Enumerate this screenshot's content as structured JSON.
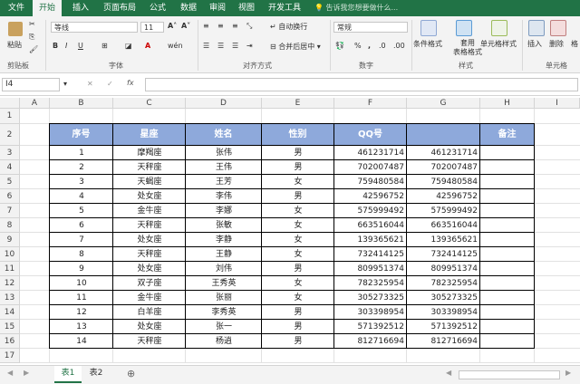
{
  "ribbon_tabs": [
    {
      "label": "文件"
    },
    {
      "label": "开始"
    },
    {
      "label": "插入"
    },
    {
      "label": "页面布局"
    },
    {
      "label": "公式"
    },
    {
      "label": "数据"
    },
    {
      "label": "审阅"
    },
    {
      "label": "视图"
    },
    {
      "label": "开发工具"
    }
  ],
  "active_tab": "开始",
  "tell_me": "告诉我您想要做什么...",
  "ribbon": {
    "paste": "粘贴",
    "clipboard": "剪贴板",
    "font_name": "等线",
    "font_size": "11",
    "font_group": "字体",
    "wrap_text": "自动换行",
    "merge_center": "合并后居中",
    "alignment_group": "对齐方式",
    "number_format": "常规",
    "number_group": "数字",
    "conditional_format": "条件格式",
    "format_as_table": "套用\n表格格式",
    "cell_styles": "单元格样式",
    "styles_group": "样式",
    "insert": "插入",
    "delete": "删除",
    "format": "格",
    "cells_group": "单元格"
  },
  "formula_bar": {
    "name_box": "I4",
    "fx": "fx",
    "content": ""
  },
  "columns": [
    "A",
    "B",
    "C",
    "D",
    "E",
    "F",
    "G",
    "H",
    "I"
  ],
  "rows": [
    "1",
    "2",
    "3",
    "4",
    "5",
    "6",
    "7",
    "8",
    "9",
    "10",
    "11",
    "12",
    "13",
    "14",
    "15",
    "16",
    "17"
  ],
  "table": {
    "headers": [
      "序号",
      "星座",
      "姓名",
      "性别",
      "QQ号",
      "",
      "备注"
    ],
    "data": [
      [
        "1",
        "摩羯座",
        "张伟",
        "男",
        "461231714",
        "461231714"
      ],
      [
        "2",
        "天秤座",
        "王伟",
        "男",
        "702007487",
        "702007487"
      ],
      [
        "3",
        "天蝎座",
        "王芳",
        "女",
        "759480584",
        "759480584"
      ],
      [
        "4",
        "处女座",
        "李伟",
        "男",
        "42596752",
        "42596752"
      ],
      [
        "5",
        "金牛座",
        "李娜",
        "女",
        "575999492",
        "575999492"
      ],
      [
        "6",
        "天秤座",
        "张敏",
        "女",
        "663516044",
        "663516044"
      ],
      [
        "7",
        "处女座",
        "李静",
        "女",
        "139365621",
        "139365621"
      ],
      [
        "8",
        "天秤座",
        "王静",
        "女",
        "732414125",
        "732414125"
      ],
      [
        "9",
        "处女座",
        "刘伟",
        "男",
        "809951374",
        "809951374"
      ],
      [
        "10",
        "双子座",
        "王秀英",
        "女",
        "782325954",
        "782325954"
      ],
      [
        "11",
        "金牛座",
        "张丽",
        "女",
        "305273325",
        "305273325"
      ],
      [
        "12",
        "白羊座",
        "李秀英",
        "男",
        "303398954",
        "303398954"
      ],
      [
        "13",
        "处女座",
        "张一",
        "男",
        "571392512",
        "571392512"
      ],
      [
        "14",
        "天秤座",
        "杨逍",
        "男",
        "812716694",
        "812716694"
      ]
    ]
  },
  "sheets": [
    {
      "label": "表1"
    },
    {
      "label": "表2"
    }
  ],
  "active_sheet": "表1",
  "colors": {
    "excel_green": "#217346",
    "header_fill": "#8ea9db"
  }
}
